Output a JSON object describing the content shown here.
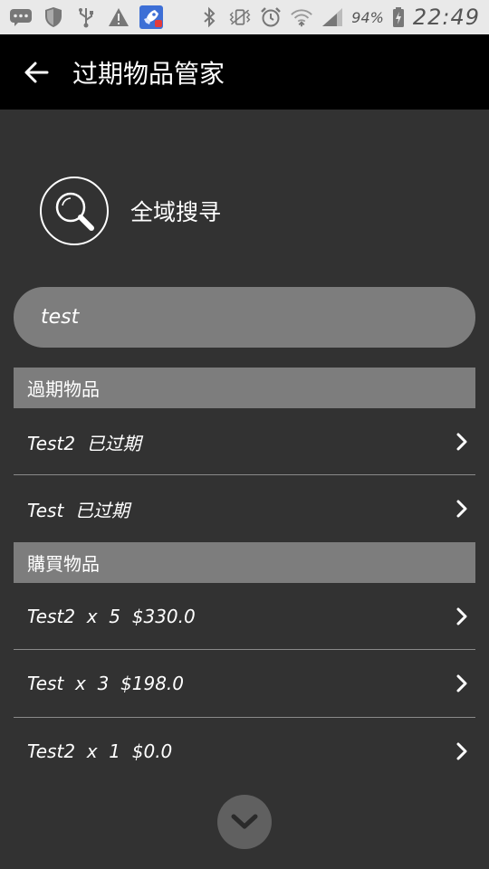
{
  "status_bar": {
    "battery_percent": "94%",
    "time": "22:49",
    "icons": [
      "message-icon",
      "shield-icon",
      "usb-icon",
      "warning-icon",
      "rocket-app-icon",
      "bluetooth-icon",
      "vibrate-icon",
      "alarm-icon",
      "wifi-icon",
      "signal-icon",
      "battery-icon"
    ]
  },
  "app_bar": {
    "title": "过期物品管家"
  },
  "search": {
    "heading": "全域搜寻",
    "query": "test"
  },
  "sections": {
    "expired": {
      "title": "過期物品",
      "items": [
        {
          "label": "Test2  已过期"
        },
        {
          "label": "Test  已过期"
        }
      ]
    },
    "purchased": {
      "title": "購買物品",
      "items": [
        {
          "label": "Test2  x  5  $330.0"
        },
        {
          "label": "Test  x  3  $198.0"
        },
        {
          "label": "Test2  x  1  $0.0"
        }
      ]
    }
  },
  "colors": {
    "background": "#323232",
    "app_bar": "#000000",
    "section_header": "#7d7d7d",
    "status_bar": "#e9e9e9"
  }
}
